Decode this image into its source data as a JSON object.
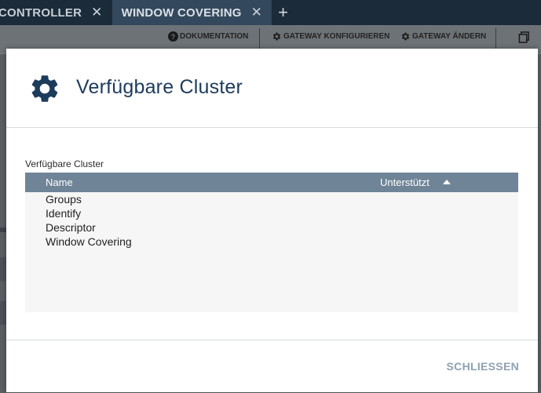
{
  "tabs": [
    {
      "label": "CONTROLLER",
      "active": false
    },
    {
      "label": "WINDOW COVERING",
      "active": true
    }
  ],
  "toolbar": {
    "documentation": "DOKUMENTATION",
    "configure_gateway": "GATEWAY KONFIGURIEREN",
    "change_gateway": "GATEWAY ÄNDERN"
  },
  "dialog": {
    "title": "Verfügbare Cluster",
    "section_label": "Verfügbare Cluster",
    "columns": {
      "name": "Name",
      "supported": "Unterstützt"
    },
    "sort": "ascending",
    "rows": [
      "Groups",
      "Identify",
      "Descriptor",
      "Window Covering"
    ],
    "close_label": "SCHLIESSEN"
  },
  "colors": {
    "title": "#1d3c5c",
    "table_header": "#6f8497",
    "tabbar": "#1c2b39",
    "close": "#8fa0af"
  }
}
